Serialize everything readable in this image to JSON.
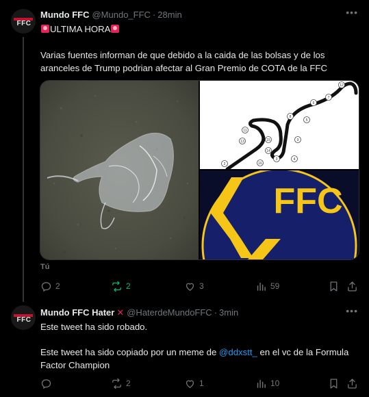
{
  "tweet1": {
    "display_name": "Mundo FFC",
    "handle": "@Mundo_FFC",
    "time": "28min",
    "headline": "ULTIMA HORA",
    "body": "Varias fuentes informan de que debido a la caida de las bolsas y de los aranceles de Trump podrian afectar al Gran Premio de COTA de la FFC",
    "media_logo_text": "FFC",
    "track_turn_numbers": [
      "12",
      "7",
      "6",
      "5",
      "11",
      "8",
      "13",
      "15",
      "9",
      "4",
      "3",
      "14",
      "16",
      "2"
    ],
    "tag_label": "Tú",
    "stats": {
      "replies": "2",
      "retweets": "2",
      "likes": "3",
      "views": "59"
    }
  },
  "tweet2": {
    "display_name": "Mundo FFC Hater",
    "handle": "@HaterdeMundoFFC",
    "time": "3min",
    "line1": "Este tweet ha sido robado.",
    "line2_before": "Este tweet ha sido copiado por un meme de ",
    "line2_mention": "@ddxstt_",
    "line2_after": " en el vc de la Formula Factor Champion",
    "stats": {
      "replies": "",
      "retweets": "2",
      "likes": "1",
      "views": "10"
    }
  },
  "avatar_text": "FFC",
  "colors": {
    "background": "#000000",
    "text": "#e7e9ea",
    "muted": "#71767b",
    "link": "#1d9bf0",
    "retweet_active": "#00ba7c",
    "ffc_gold": "#f5c518",
    "ffc_navy": "#16206a"
  },
  "icons": [
    "more-icon",
    "reply-icon",
    "retweet-icon",
    "like-icon",
    "views-icon",
    "bookmark-icon",
    "share-icon",
    "siren-icon",
    "cross-mark-icon"
  ]
}
